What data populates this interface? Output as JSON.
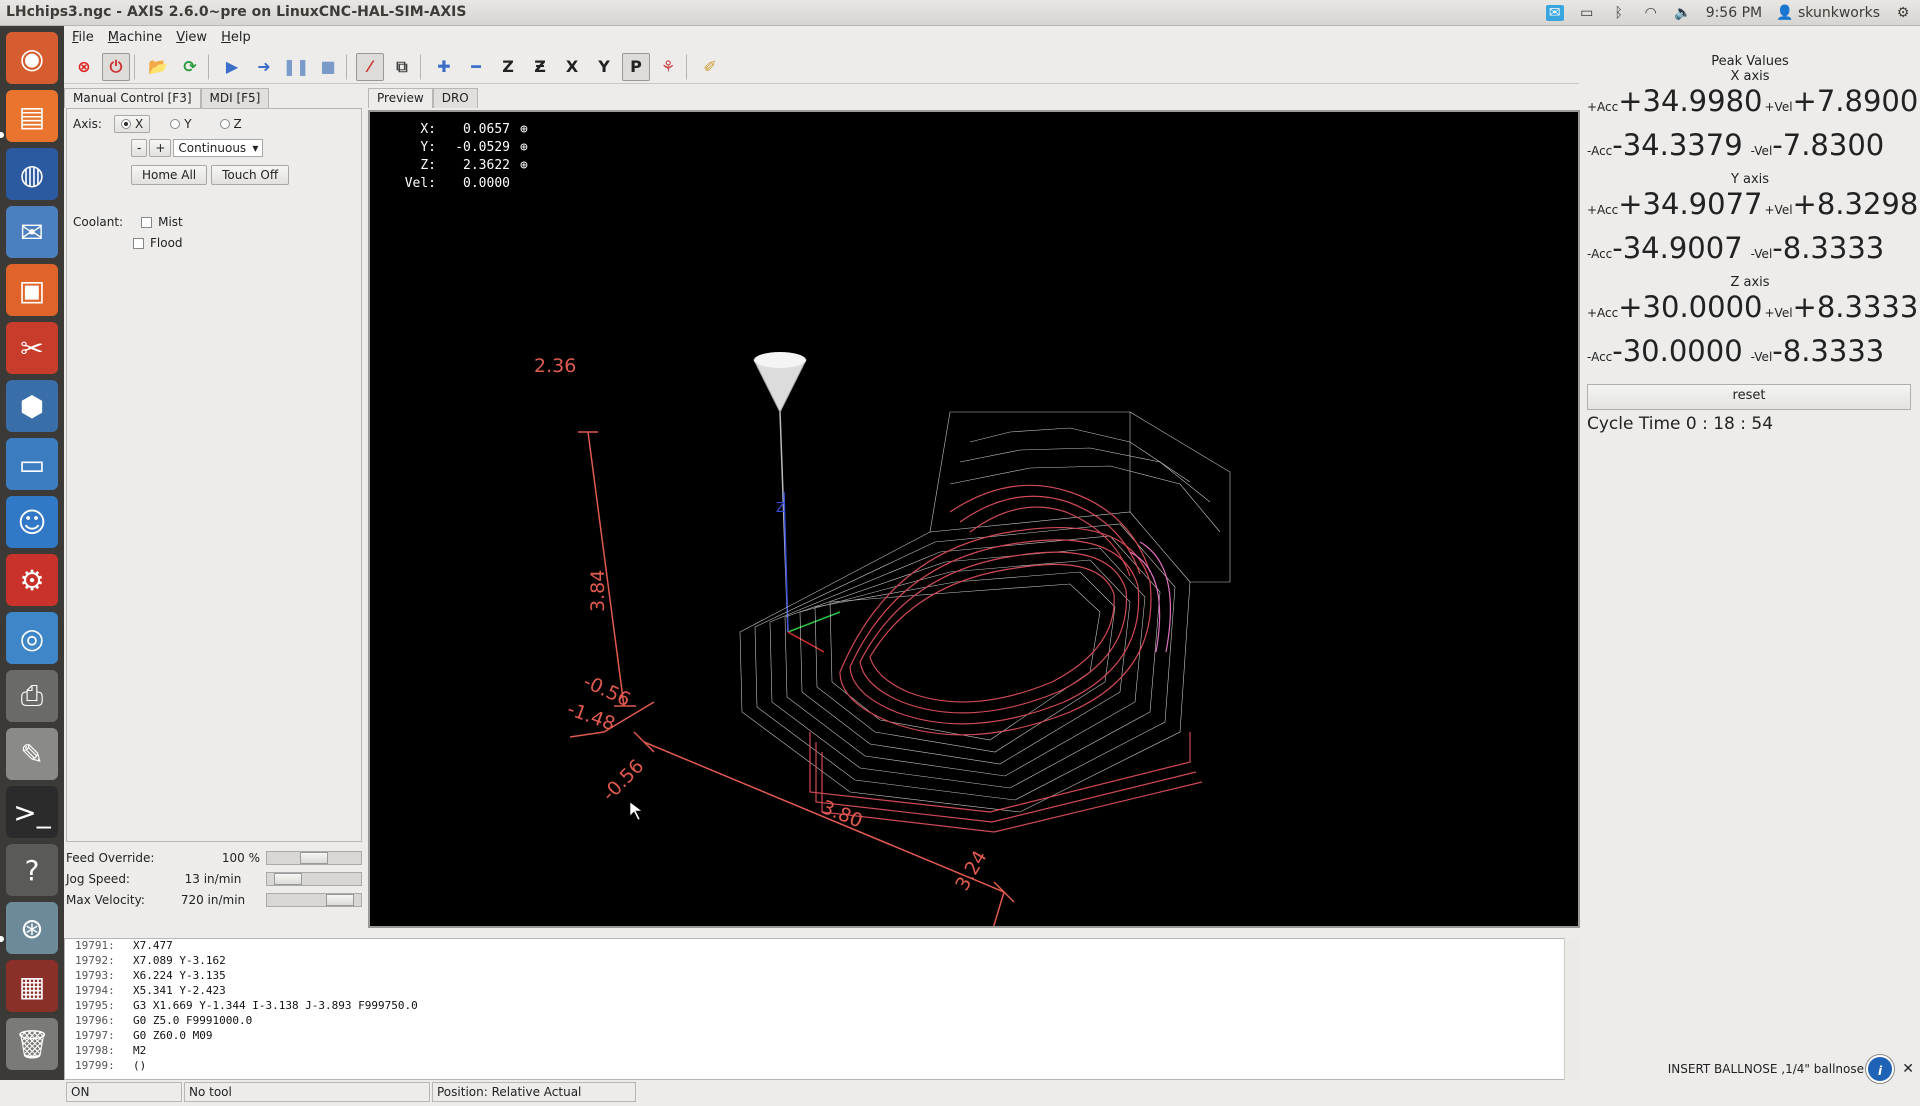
{
  "window_title": "LHchips3.ngc - AXIS 2.6.0~pre on LinuxCNC-HAL-SIM-AXIS",
  "tray": {
    "time": "9:56 PM",
    "user": "skunkworks"
  },
  "menu": [
    "File",
    "Machine",
    "View",
    "Help"
  ],
  "left_tabs": [
    "Manual Control [F3]",
    "MDI [F5]"
  ],
  "manual": {
    "axis_label": "Axis:",
    "axes": [
      "X",
      "Y",
      "Z"
    ],
    "selected_axis": "X",
    "jog_minus": "-",
    "jog_plus": "+",
    "jog_mode": "Continuous",
    "home_all": "Home All",
    "touch_off": "Touch Off",
    "coolant_label": "Coolant:",
    "mist": "Mist",
    "flood": "Flood"
  },
  "sliders": {
    "feed_label": "Feed Override:",
    "feed_value": "100 %",
    "feed_fraction": 0.5,
    "jog_label": "Jog Speed:",
    "jog_value": "13 in/min",
    "jog_fraction": 0.1,
    "maxvel_label": "Max Velocity:",
    "maxvel_value": "720 in/min",
    "maxvel_fraction": 0.9
  },
  "center_tabs": [
    "Preview",
    "DRO"
  ],
  "dro": [
    {
      "label": "X:",
      "value": "0.0657"
    },
    {
      "label": "Y:",
      "value": "-0.0529"
    },
    {
      "label": "Z:",
      "value": "2.3622"
    },
    {
      "label": "Vel:",
      "value": "0.0000"
    }
  ],
  "preview_labels": {
    "z_top": "2.36",
    "z_len": "3.84",
    "z_low": "-0.56",
    "z_min": "-1.48",
    "x_min": "-0.56",
    "x_len": "3.80",
    "y_len": "3.24",
    "tool_axis": "Z"
  },
  "peak": {
    "title": "Peak Values",
    "axes": [
      {
        "name": "X axis",
        "pacc": "+34.9980",
        "pvel": "+7.8900",
        "nacc": "-34.3379",
        "nvel": "-7.8300"
      },
      {
        "name": "Y axis",
        "pacc": "+34.9077",
        "pvel": "+8.3298",
        "nacc": "-34.9007",
        "nvel": "-8.3333"
      },
      {
        "name": "Z axis",
        "pacc": "+30.0000",
        "pvel": "+8.3333",
        "nacc": "-30.0000",
        "nvel": "-8.3333"
      }
    ],
    "lab_pacc": "+Acc",
    "lab_pvel": "+Vel",
    "lab_nacc": "-Acc",
    "lab_nvel": "-Vel",
    "reset": "reset",
    "cycle_time": "Cycle Time  0 : 18 : 54"
  },
  "gcode": [
    {
      "n": "19791:",
      "t": "X7.477"
    },
    {
      "n": "19792:",
      "t": "X7.089 Y-3.162"
    },
    {
      "n": "19793:",
      "t": "X6.224 Y-3.135"
    },
    {
      "n": "19794:",
      "t": "X5.341 Y-2.423"
    },
    {
      "n": "19795:",
      "t": "G3 X1.669 Y-1.344 I-3.138 J-3.893 F999750.0"
    },
    {
      "n": "19796:",
      "t": "G0 Z5.0 F9991000.0"
    },
    {
      "n": "19797:",
      "t": "G0 Z60.0 M09"
    },
    {
      "n": "19798:",
      "t": "M2"
    },
    {
      "n": "19799:",
      "t": "()"
    }
  ],
  "status": {
    "state": "ON",
    "tool": "No tool",
    "position": "Position: Relative Actual"
  },
  "notice": "INSERT BALLNOSE  ,1/4\" ballnose",
  "colors": {
    "extents": "#e05a50",
    "path": "#d04a55",
    "rapid": "#f0f0f0"
  }
}
